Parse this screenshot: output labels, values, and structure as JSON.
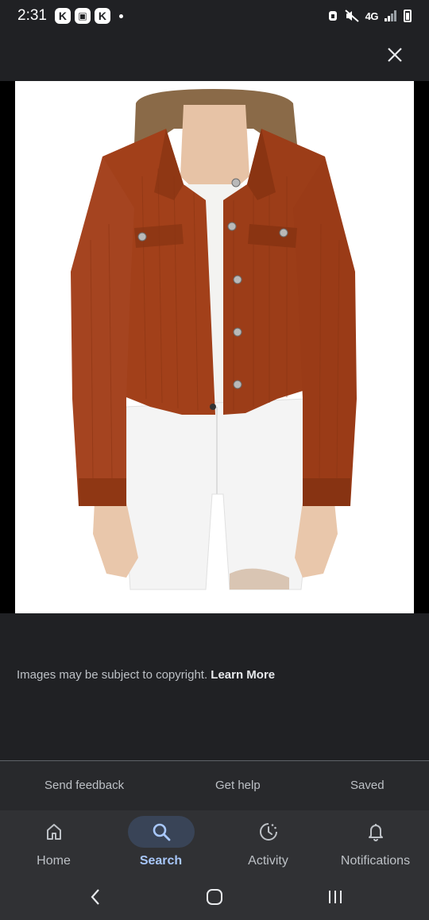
{
  "status_bar": {
    "time": "2:31",
    "app_badges": [
      "K",
      "▣",
      "K"
    ],
    "network": "4G"
  },
  "viewer": {
    "image_alt": "Rust corduroy cropped jacket"
  },
  "copyright": {
    "text": "Images may be subject to copyright.",
    "link": "Learn More"
  },
  "footer": {
    "send_feedback": "Send feedback",
    "get_help": "Get help",
    "saved": "Saved"
  },
  "bottom_nav": {
    "items": [
      {
        "label": "Home",
        "icon": "home-icon"
      },
      {
        "label": "Search",
        "icon": "search-icon",
        "active": true
      },
      {
        "label": "Activity",
        "icon": "activity-icon"
      },
      {
        "label": "Notifications",
        "icon": "bell-icon"
      }
    ]
  },
  "colors": {
    "background": "#202124",
    "nav_background": "#303134",
    "active_pill": "#394457",
    "active_label": "#a8c7fa",
    "jacket": "#a2401a"
  }
}
